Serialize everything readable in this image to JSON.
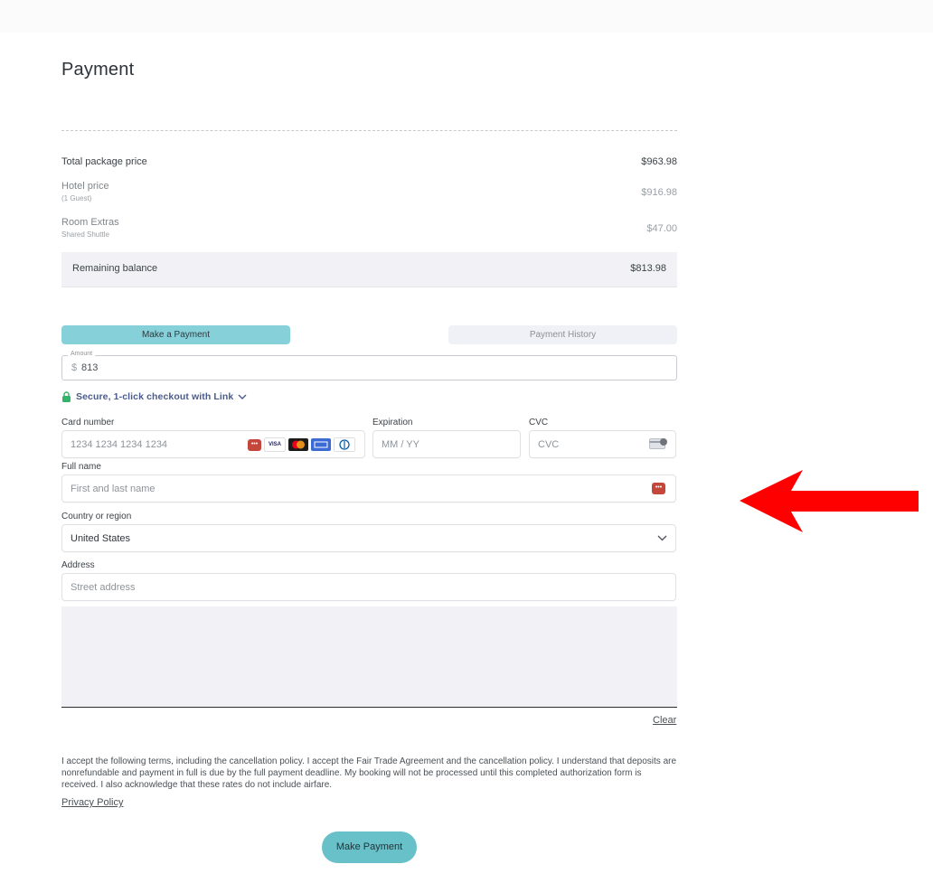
{
  "page": {
    "title": "Payment"
  },
  "summary": {
    "total": {
      "label": "Total package price",
      "value": "$963.98"
    },
    "hotel": {
      "label": "Hotel price",
      "sub": "(1 Guest)",
      "value": "$916.98"
    },
    "extras": {
      "label": "Room Extras",
      "sub": "Shared Shuttle",
      "value": "$47.00"
    },
    "balance": {
      "label": "Remaining balance",
      "value": "$813.98"
    }
  },
  "tabs": {
    "make_payment": "Make a Payment",
    "history": "Payment History"
  },
  "amount": {
    "legend": "Amount",
    "currency": "$",
    "value": "813"
  },
  "link": {
    "label": "Secure, 1-click checkout with Link"
  },
  "card": {
    "number_label": "Card number",
    "number_placeholder": "1234 1234 1234 1234",
    "expiry_label": "Expiration",
    "expiry_placeholder": "MM / YY",
    "cvc_label": "CVC",
    "cvc_placeholder": "CVC",
    "brands": [
      "VISA"
    ]
  },
  "fullname": {
    "label": "Full name",
    "placeholder": "First and last name"
  },
  "country": {
    "label": "Country or region",
    "value": "United States"
  },
  "address": {
    "label": "Address",
    "placeholder": "Street address"
  },
  "signature": {
    "clear_label": "Clear"
  },
  "terms": {
    "text": "I accept the following terms, including the cancellation policy. I accept the Fair Trade Agreement and the cancellation policy. I understand that deposits are nonrefundable and payment in full is due by the full payment deadline. My booking will not be processed until this completed authorization form is received. I also acknowledge that these rates do not include airfare.",
    "privacy_label": "Privacy Policy"
  },
  "submit": {
    "label": "Make Payment"
  },
  "colors": {
    "accent": "#68c0c8",
    "tab_active": "#86d0d9",
    "annotation_arrow": "#ff0000",
    "autofill": "#c5473b"
  }
}
